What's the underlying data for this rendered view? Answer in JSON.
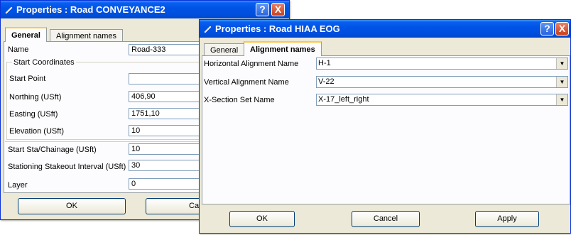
{
  "back_window": {
    "title": "Properties : Road CONVEYANCE2",
    "tabs": [
      "General",
      "Alignment names"
    ],
    "rows": {
      "name_label": "Name",
      "name_value": "Road-333",
      "start_coords_label": "Start Coordinates",
      "start_point_label": "Start Point",
      "start_point_value": "",
      "northing_label": "Northing (USft)",
      "northing_value": "406,90",
      "easting_label": "Easting (USft)",
      "easting_value": "1751,10",
      "elevation_label": "Elevation (USft)",
      "elevation_value": "10",
      "start_sta_label": "Start Sta/Chainage (USft)",
      "start_sta_value": "10",
      "stakeout_label": "Stationing Stakeout Interval (USft)",
      "stakeout_value": "30",
      "layer_label": "Layer",
      "layer_value": "0"
    },
    "ok_label": "OK",
    "cancel_label": "Ca"
  },
  "front_window": {
    "title": "Properties : Road HIAA EOG",
    "tabs": [
      "General",
      "Alignment names"
    ],
    "horizontal_label": "Horizontal Alignment Name",
    "horizontal_value": "H-1",
    "vertical_label": "Vertical Alignment Name",
    "vertical_value": "V-22",
    "xsection_label": "X-Section Set Name",
    "xsection_value": "X-17_left_right",
    "ok_label": "OK",
    "cancel_label": "Cancel",
    "apply_label": "Apply"
  },
  "title_buttons": {
    "help": "?",
    "close": "X"
  },
  "colors": {
    "titlebar": "#0054e3",
    "face": "#ece9d8",
    "tab_highlight": "#ffc83c"
  }
}
